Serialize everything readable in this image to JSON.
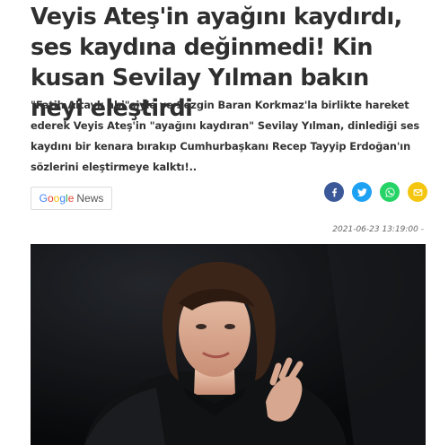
{
  "article": {
    "title": "Veyis Ateş'in ayağını kaydırdı, ses kaydına değinmedi! Kin kusan Sevilay Yılman bakın neyi eleştirdi",
    "summary": "\"Fatih Altaylı abi\"siyle ve Sezgin Baran Korkmaz'la birlikte hareket ederek Veyis Ateş'in \"ayağını kaydıran\" Sevilay Yılman, dinlediği ses kaydını bir kenara bırakıp Cumhurbaşkanı Recep Tayyip Erdoğan'ın sözlerini eleştirmeye kalktı!..",
    "date": "2021-06-23 13:19:00 -"
  },
  "google_news": {
    "brand": "Google",
    "label": "News",
    "brand_colors": [
      "#4285F4",
      "#EA4335",
      "#FBBC05",
      "#4285F4",
      "#34A853",
      "#EA4335"
    ]
  },
  "share": [
    {
      "name": "facebook",
      "icon": "facebook-icon",
      "color": "#3b5998"
    },
    {
      "name": "twitter",
      "icon": "twitter-icon",
      "color": "#1da1f2"
    },
    {
      "name": "whatsapp",
      "icon": "whatsapp-icon",
      "color": "#25d366"
    },
    {
      "name": "email",
      "icon": "email-icon",
      "color": "#f4c60f"
    }
  ]
}
